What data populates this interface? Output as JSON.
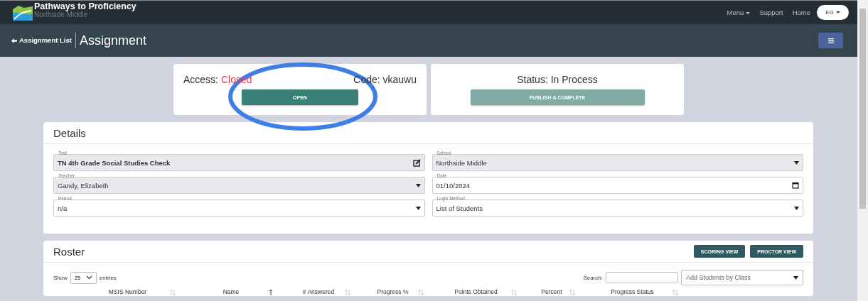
{
  "brand": {
    "title": "Pathways to Proficiency",
    "subtitle": "Northside Middle"
  },
  "nav": {
    "items": [
      {
        "label": "Menu",
        "dropdown": true
      },
      {
        "label": "Support",
        "dropdown": false
      },
      {
        "label": "Home",
        "dropdown": false
      }
    ],
    "user": "EG"
  },
  "subheader": {
    "back_link": "Assignment List",
    "title": "Assignment"
  },
  "access_card": {
    "label": "Access:",
    "value": "Closed",
    "code_label": "Code:",
    "code": "vkauwu",
    "button": "OPEN"
  },
  "status_card": {
    "label": "Status: In Process",
    "button": "PUBLISH & COMPLETE",
    "button_disabled": true
  },
  "details": {
    "title": "Details",
    "fields": [
      {
        "label": "Test",
        "value": "TN 4th Grade Social Studies Check",
        "kind": "edit",
        "disabled": true
      },
      {
        "label": "School",
        "value": "Northside Middle",
        "kind": "select",
        "disabled": true
      },
      {
        "label": "Teacher",
        "value": "Gandy, Elizabeth",
        "kind": "select",
        "disabled": true
      },
      {
        "label": "Date",
        "value": "01/10/2024",
        "kind": "date",
        "disabled": false
      },
      {
        "label": "Period",
        "value": "n/a",
        "kind": "select",
        "disabled": false
      },
      {
        "label": "Login Method",
        "value": "List of Students",
        "kind": "select",
        "disabled": false
      }
    ]
  },
  "roster": {
    "title": "Roster",
    "buttons": [
      "SCORING VIEW",
      "PROCTOR VIEW"
    ],
    "show_label": "Show",
    "page_size": "25",
    "entries_label": "entries",
    "search_label": "Search:",
    "class_select": "Add Students by Class",
    "columns": [
      {
        "label": "MSIS Number",
        "sorted": false
      },
      {
        "label": "Name",
        "sorted": true
      },
      {
        "label": "# Answered",
        "sorted": false
      },
      {
        "label": "Progress %",
        "sorted": false
      },
      {
        "label": "Points Obtained",
        "sorted": false
      },
      {
        "label": "Percent",
        "sorted": false
      },
      {
        "label": "Progress Status",
        "sorted": false
      }
    ]
  }
}
